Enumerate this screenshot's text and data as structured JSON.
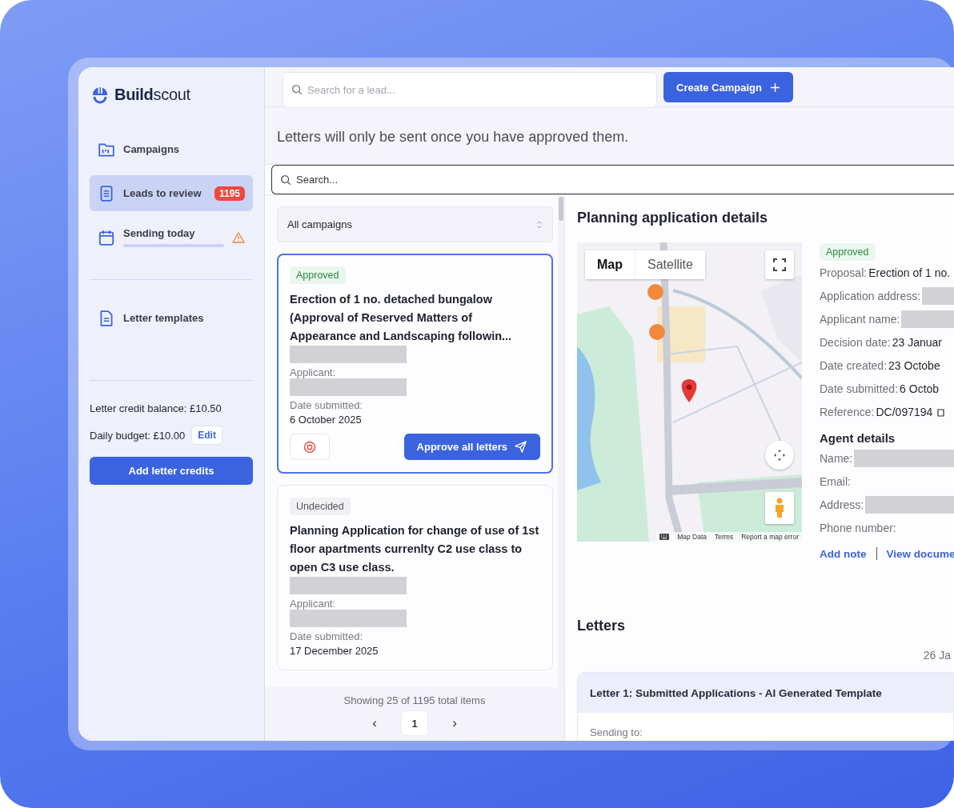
{
  "brand": {
    "bold": "Build",
    "rest": "scout"
  },
  "sidebar": {
    "items": [
      {
        "label": "Campaigns",
        "selected": false,
        "warning": false
      },
      {
        "label": "Leads to review",
        "selected": true,
        "badge": "1195",
        "warning": false
      },
      {
        "label": "Sending today",
        "selected": false,
        "warning": true,
        "progress": true
      }
    ],
    "templates": {
      "label": "Letter templates",
      "selected": false
    },
    "credit_balance": "Letter credit balance: £10.50",
    "daily_budget": "Daily budget: £10.00",
    "edit_button": "Edit",
    "add_credits_button": "Add letter credits"
  },
  "topbar": {
    "search": {
      "placeholder": "Search for a lead..."
    },
    "create_button": "Create Campaign"
  },
  "notice": "Letters will only be sent once you have approved them.",
  "search": {
    "placeholder": "Search..."
  },
  "campaign_filter": "All campaigns",
  "leads": [
    {
      "status": "Approved",
      "kind": "approved",
      "selected": true,
      "title": "Erection of 1 no. detached bungalow (Approval of Reserved Matters of Appearance and Landscaping followin...",
      "applicant_label": "Applicant:",
      "date_label": "Date submitted:",
      "date": "6 October 2025",
      "approve_button": "Approve all letters"
    },
    {
      "status": "Undecided",
      "kind": "undecided",
      "selected": false,
      "title": "Planning Application for change of use of 1st floor apartments currenlty C2 use class to open C3 use class.",
      "applicant_label": "Applicant:",
      "date_label": "Date submitted:",
      "date": "17 December 2025"
    }
  ],
  "pagination": {
    "summary": "Showing 25 of 1195 total items",
    "prev": "‹",
    "page": "1",
    "next": "›"
  },
  "details": {
    "title": "Planning application details",
    "map": {
      "kind": "picture",
      "view_toggle": [
        {
          "label": "Map",
          "selected": true
        },
        {
          "label": "Satellite",
          "selected": false
        }
      ],
      "attribution": [
        "Map Data",
        "Terms",
        "Report a map error"
      ]
    },
    "status": {
      "label": "Approved",
      "kind": "approved"
    },
    "fields": [
      {
        "label": "Proposal:",
        "value": "Erection of 1 no.",
        "redacted": false
      },
      {
        "label": "Application address:",
        "redacted": true
      },
      {
        "label": "Applicant name:",
        "redacted": true
      },
      {
        "label": "Decision date:",
        "value": "23 Januar",
        "redacted": false
      },
      {
        "label": "Date created:",
        "value": "23 Octobe",
        "redacted": false
      },
      {
        "label": "Date submitted:",
        "value": "6 Octob",
        "redacted": false
      },
      {
        "label": "Reference:",
        "value": "DC/097194",
        "redacted": false,
        "external": true
      }
    ],
    "agent_title": "Agent details",
    "agent_fields": [
      {
        "label": "Name:",
        "redacted": true
      },
      {
        "label": "Email:",
        "redacted": false
      },
      {
        "label": "Address:",
        "redacted": true
      },
      {
        "label": "Phone number:",
        "redacted": false
      }
    ],
    "links": [
      "Add note",
      "View docume"
    ]
  },
  "letters": {
    "title": "Letters",
    "date": "26 Ja",
    "items": [
      {
        "title": "Letter 1: Submitted Applications - AI Generated Template",
        "sending_label": "Sending to:"
      }
    ]
  }
}
